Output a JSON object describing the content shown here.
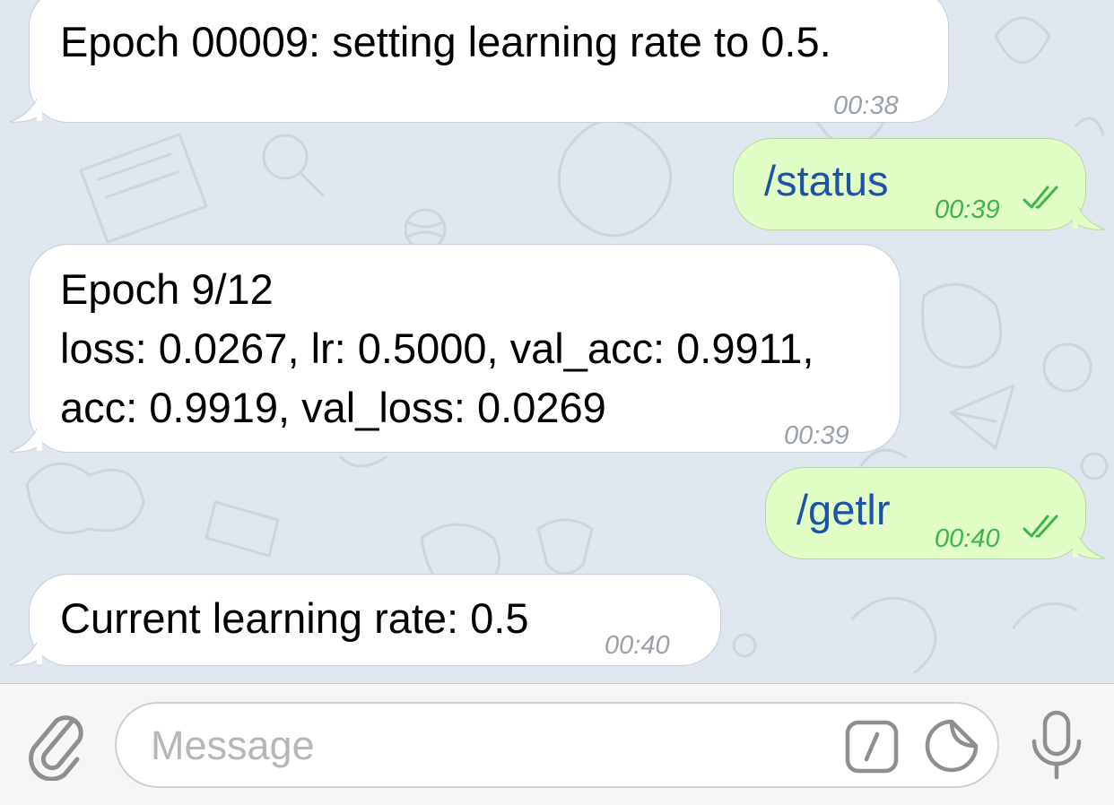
{
  "messages": [
    {
      "direction": "incoming",
      "text": "Epoch 00009: setting learning rate to 0.5.",
      "time": "00:38"
    },
    {
      "direction": "outgoing",
      "text": "/status",
      "time": "00:39",
      "status": "read"
    },
    {
      "direction": "incoming",
      "lines": [
        "Epoch 9/12",
        "loss: 0.0267, lr: 0.5000, val_acc: 0.9911,",
        "acc: 0.9919, val_loss: 0.0269"
      ],
      "time": "00:39"
    },
    {
      "direction": "outgoing",
      "text": "/getlr",
      "time": "00:40",
      "status": "read"
    },
    {
      "direction": "incoming",
      "text": "Current learning rate: 0.5",
      "time": "00:40"
    }
  ],
  "input": {
    "placeholder": "Message",
    "value": ""
  },
  "icons": {
    "attach": "paperclip-icon",
    "commands": "slash-command-icon",
    "sticker": "sticker-icon",
    "voice": "microphone-icon",
    "read_receipt": "double-check-icon"
  },
  "colors": {
    "background": "#dfe6ee",
    "incoming_bubble": "#ffffff",
    "outgoing_bubble": "#e1fec6",
    "command_text": "#1c53a8",
    "outgoing_time": "#3cb54a",
    "incoming_time": "#9aa1a8",
    "icon_gray": "#8e8e93"
  }
}
